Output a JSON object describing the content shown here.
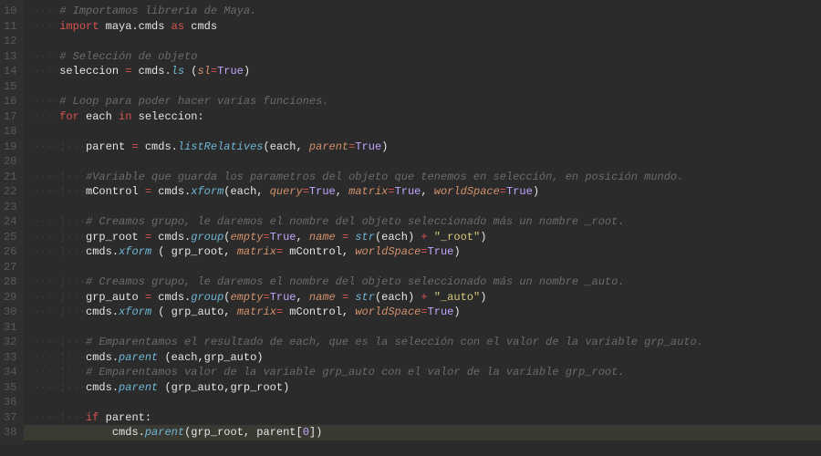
{
  "lines": [
    {
      "n": 10,
      "indent": 1,
      "tokens": [
        [
          "cmt",
          "# Importamos libreria de Maya."
        ]
      ]
    },
    {
      "n": 11,
      "indent": 1,
      "tokens": [
        [
          "kw",
          "import"
        ],
        [
          "id",
          " maya.cmds "
        ],
        [
          "kw",
          "as"
        ],
        [
          "id",
          " cmds"
        ]
      ]
    },
    {
      "n": 12,
      "indent": 0,
      "tokens": []
    },
    {
      "n": 13,
      "indent": 1,
      "tokens": [
        [
          "cmt",
          "# Selección de objeto"
        ]
      ]
    },
    {
      "n": 14,
      "indent": 1,
      "tokens": [
        [
          "id",
          "seleccion "
        ],
        [
          "op",
          "="
        ],
        [
          "id",
          " cmds."
        ],
        [
          "fn",
          "ls"
        ],
        [
          "id",
          " ("
        ],
        [
          "par",
          "sl"
        ],
        [
          "op",
          "="
        ],
        [
          "bol",
          "True"
        ],
        [
          "id",
          ")"
        ]
      ]
    },
    {
      "n": 15,
      "indent": 0,
      "tokens": []
    },
    {
      "n": 16,
      "indent": 1,
      "tokens": [
        [
          "cmt",
          "# Loop para poder hacer varias funciones."
        ]
      ]
    },
    {
      "n": 17,
      "indent": 1,
      "tokens": [
        [
          "kw",
          "for"
        ],
        [
          "id",
          " each "
        ],
        [
          "kw",
          "in"
        ],
        [
          "id",
          " seleccion:"
        ]
      ]
    },
    {
      "n": 18,
      "indent": 0,
      "tokens": []
    },
    {
      "n": 19,
      "indent": 2,
      "tokens": [
        [
          "id",
          "parent "
        ],
        [
          "op",
          "="
        ],
        [
          "id",
          " cmds."
        ],
        [
          "fn",
          "listRelatives"
        ],
        [
          "id",
          "(each, "
        ],
        [
          "par",
          "parent"
        ],
        [
          "op",
          "="
        ],
        [
          "bol",
          "True"
        ],
        [
          "id",
          ")"
        ]
      ]
    },
    {
      "n": 20,
      "indent": 0,
      "tokens": []
    },
    {
      "n": 21,
      "indent": 2,
      "tokens": [
        [
          "cmt",
          "#Variable que guarda los parametros del objeto que tenemos en selección, en posición mundo."
        ]
      ]
    },
    {
      "n": 22,
      "indent": 2,
      "tokens": [
        [
          "id",
          "mControl "
        ],
        [
          "op",
          "="
        ],
        [
          "id",
          " cmds."
        ],
        [
          "fn",
          "xform"
        ],
        [
          "id",
          "(each, "
        ],
        [
          "par",
          "query"
        ],
        [
          "op",
          "="
        ],
        [
          "bol",
          "True"
        ],
        [
          "id",
          ", "
        ],
        [
          "par",
          "matrix"
        ],
        [
          "op",
          "="
        ],
        [
          "bol",
          "True"
        ],
        [
          "id",
          ", "
        ],
        [
          "par",
          "worldSpace"
        ],
        [
          "op",
          "="
        ],
        [
          "bol",
          "True"
        ],
        [
          "id",
          ")"
        ]
      ]
    },
    {
      "n": 23,
      "indent": 0,
      "tokens": []
    },
    {
      "n": 24,
      "indent": 2,
      "tokens": [
        [
          "cmt",
          "# Creamos grupo, le daremos el nombre del objeto seleccionado más un nombre _root."
        ]
      ]
    },
    {
      "n": 25,
      "indent": 2,
      "tokens": [
        [
          "id",
          "grp_root "
        ],
        [
          "op",
          "="
        ],
        [
          "id",
          " cmds."
        ],
        [
          "fn",
          "group"
        ],
        [
          "id",
          "("
        ],
        [
          "par",
          "empty"
        ],
        [
          "op",
          "="
        ],
        [
          "bol",
          "True"
        ],
        [
          "id",
          ", "
        ],
        [
          "par",
          "name"
        ],
        [
          "id",
          " "
        ],
        [
          "op",
          "="
        ],
        [
          "id",
          " "
        ],
        [
          "bi",
          "str"
        ],
        [
          "id",
          "(each) "
        ],
        [
          "op",
          "+"
        ],
        [
          "id",
          " "
        ],
        [
          "str",
          "\"_root\""
        ],
        [
          "id",
          ")"
        ]
      ]
    },
    {
      "n": 26,
      "indent": 2,
      "tokens": [
        [
          "id",
          "cmds."
        ],
        [
          "fn",
          "xform"
        ],
        [
          "id",
          " ( grp_root, "
        ],
        [
          "par",
          "matrix"
        ],
        [
          "op",
          "="
        ],
        [
          "id",
          " mControl, "
        ],
        [
          "par",
          "worldSpace"
        ],
        [
          "op",
          "="
        ],
        [
          "bol",
          "True"
        ],
        [
          "id",
          ")"
        ]
      ]
    },
    {
      "n": 27,
      "indent": 0,
      "tokens": []
    },
    {
      "n": 28,
      "indent": 2,
      "tokens": [
        [
          "cmt",
          "# Creamos grupo, le daremos el nombre del objeto seleccionado más un nombre _auto."
        ]
      ]
    },
    {
      "n": 29,
      "indent": 2,
      "tokens": [
        [
          "id",
          "grp_auto "
        ],
        [
          "op",
          "="
        ],
        [
          "id",
          " cmds."
        ],
        [
          "fn",
          "group"
        ],
        [
          "id",
          "("
        ],
        [
          "par",
          "empty"
        ],
        [
          "op",
          "="
        ],
        [
          "bol",
          "True"
        ],
        [
          "id",
          ", "
        ],
        [
          "par",
          "name"
        ],
        [
          "id",
          " "
        ],
        [
          "op",
          "="
        ],
        [
          "id",
          " "
        ],
        [
          "bi",
          "str"
        ],
        [
          "id",
          "(each) "
        ],
        [
          "op",
          "+"
        ],
        [
          "id",
          " "
        ],
        [
          "str",
          "\"_auto\""
        ],
        [
          "id",
          ")"
        ]
      ]
    },
    {
      "n": 30,
      "indent": 2,
      "tokens": [
        [
          "id",
          "cmds."
        ],
        [
          "fn",
          "xform"
        ],
        [
          "id",
          " ( grp_auto, "
        ],
        [
          "par",
          "matrix"
        ],
        [
          "op",
          "="
        ],
        [
          "id",
          " mControl, "
        ],
        [
          "par",
          "worldSpace"
        ],
        [
          "op",
          "="
        ],
        [
          "bol",
          "True"
        ],
        [
          "id",
          ")"
        ]
      ]
    },
    {
      "n": 31,
      "indent": 0,
      "tokens": []
    },
    {
      "n": 32,
      "indent": 2,
      "tokens": [
        [
          "cmt",
          "# Emparentamos el resultado de each, que es la selección con el valor de la variable grp_auto."
        ]
      ]
    },
    {
      "n": 33,
      "indent": 2,
      "tokens": [
        [
          "id",
          "cmds."
        ],
        [
          "fn",
          "parent"
        ],
        [
          "id",
          " (each,grp_auto)"
        ]
      ]
    },
    {
      "n": 34,
      "indent": 2,
      "tokens": [
        [
          "cmt",
          "# Emparentamos valor de la variable grp_auto con el valor de la variable grp_root."
        ]
      ]
    },
    {
      "n": 35,
      "indent": 2,
      "tokens": [
        [
          "id",
          "cmds."
        ],
        [
          "fn",
          "parent"
        ],
        [
          "id",
          " (grp_auto,grp_root)"
        ]
      ]
    },
    {
      "n": 36,
      "indent": 0,
      "tokens": []
    },
    {
      "n": 37,
      "indent": 2,
      "tokens": [
        [
          "kw",
          "if"
        ],
        [
          "id",
          " parent:"
        ]
      ]
    },
    {
      "n": 38,
      "indent": 3,
      "tokens": [
        [
          "id",
          "cmds."
        ],
        [
          "fn",
          "parent"
        ],
        [
          "id",
          "(grp_root, parent["
        ],
        [
          "num",
          "0"
        ],
        [
          "id",
          "])"
        ]
      ],
      "current": true
    }
  ],
  "indent_glyph_first": "····",
  "indent_glyph_rest": "¦···"
}
